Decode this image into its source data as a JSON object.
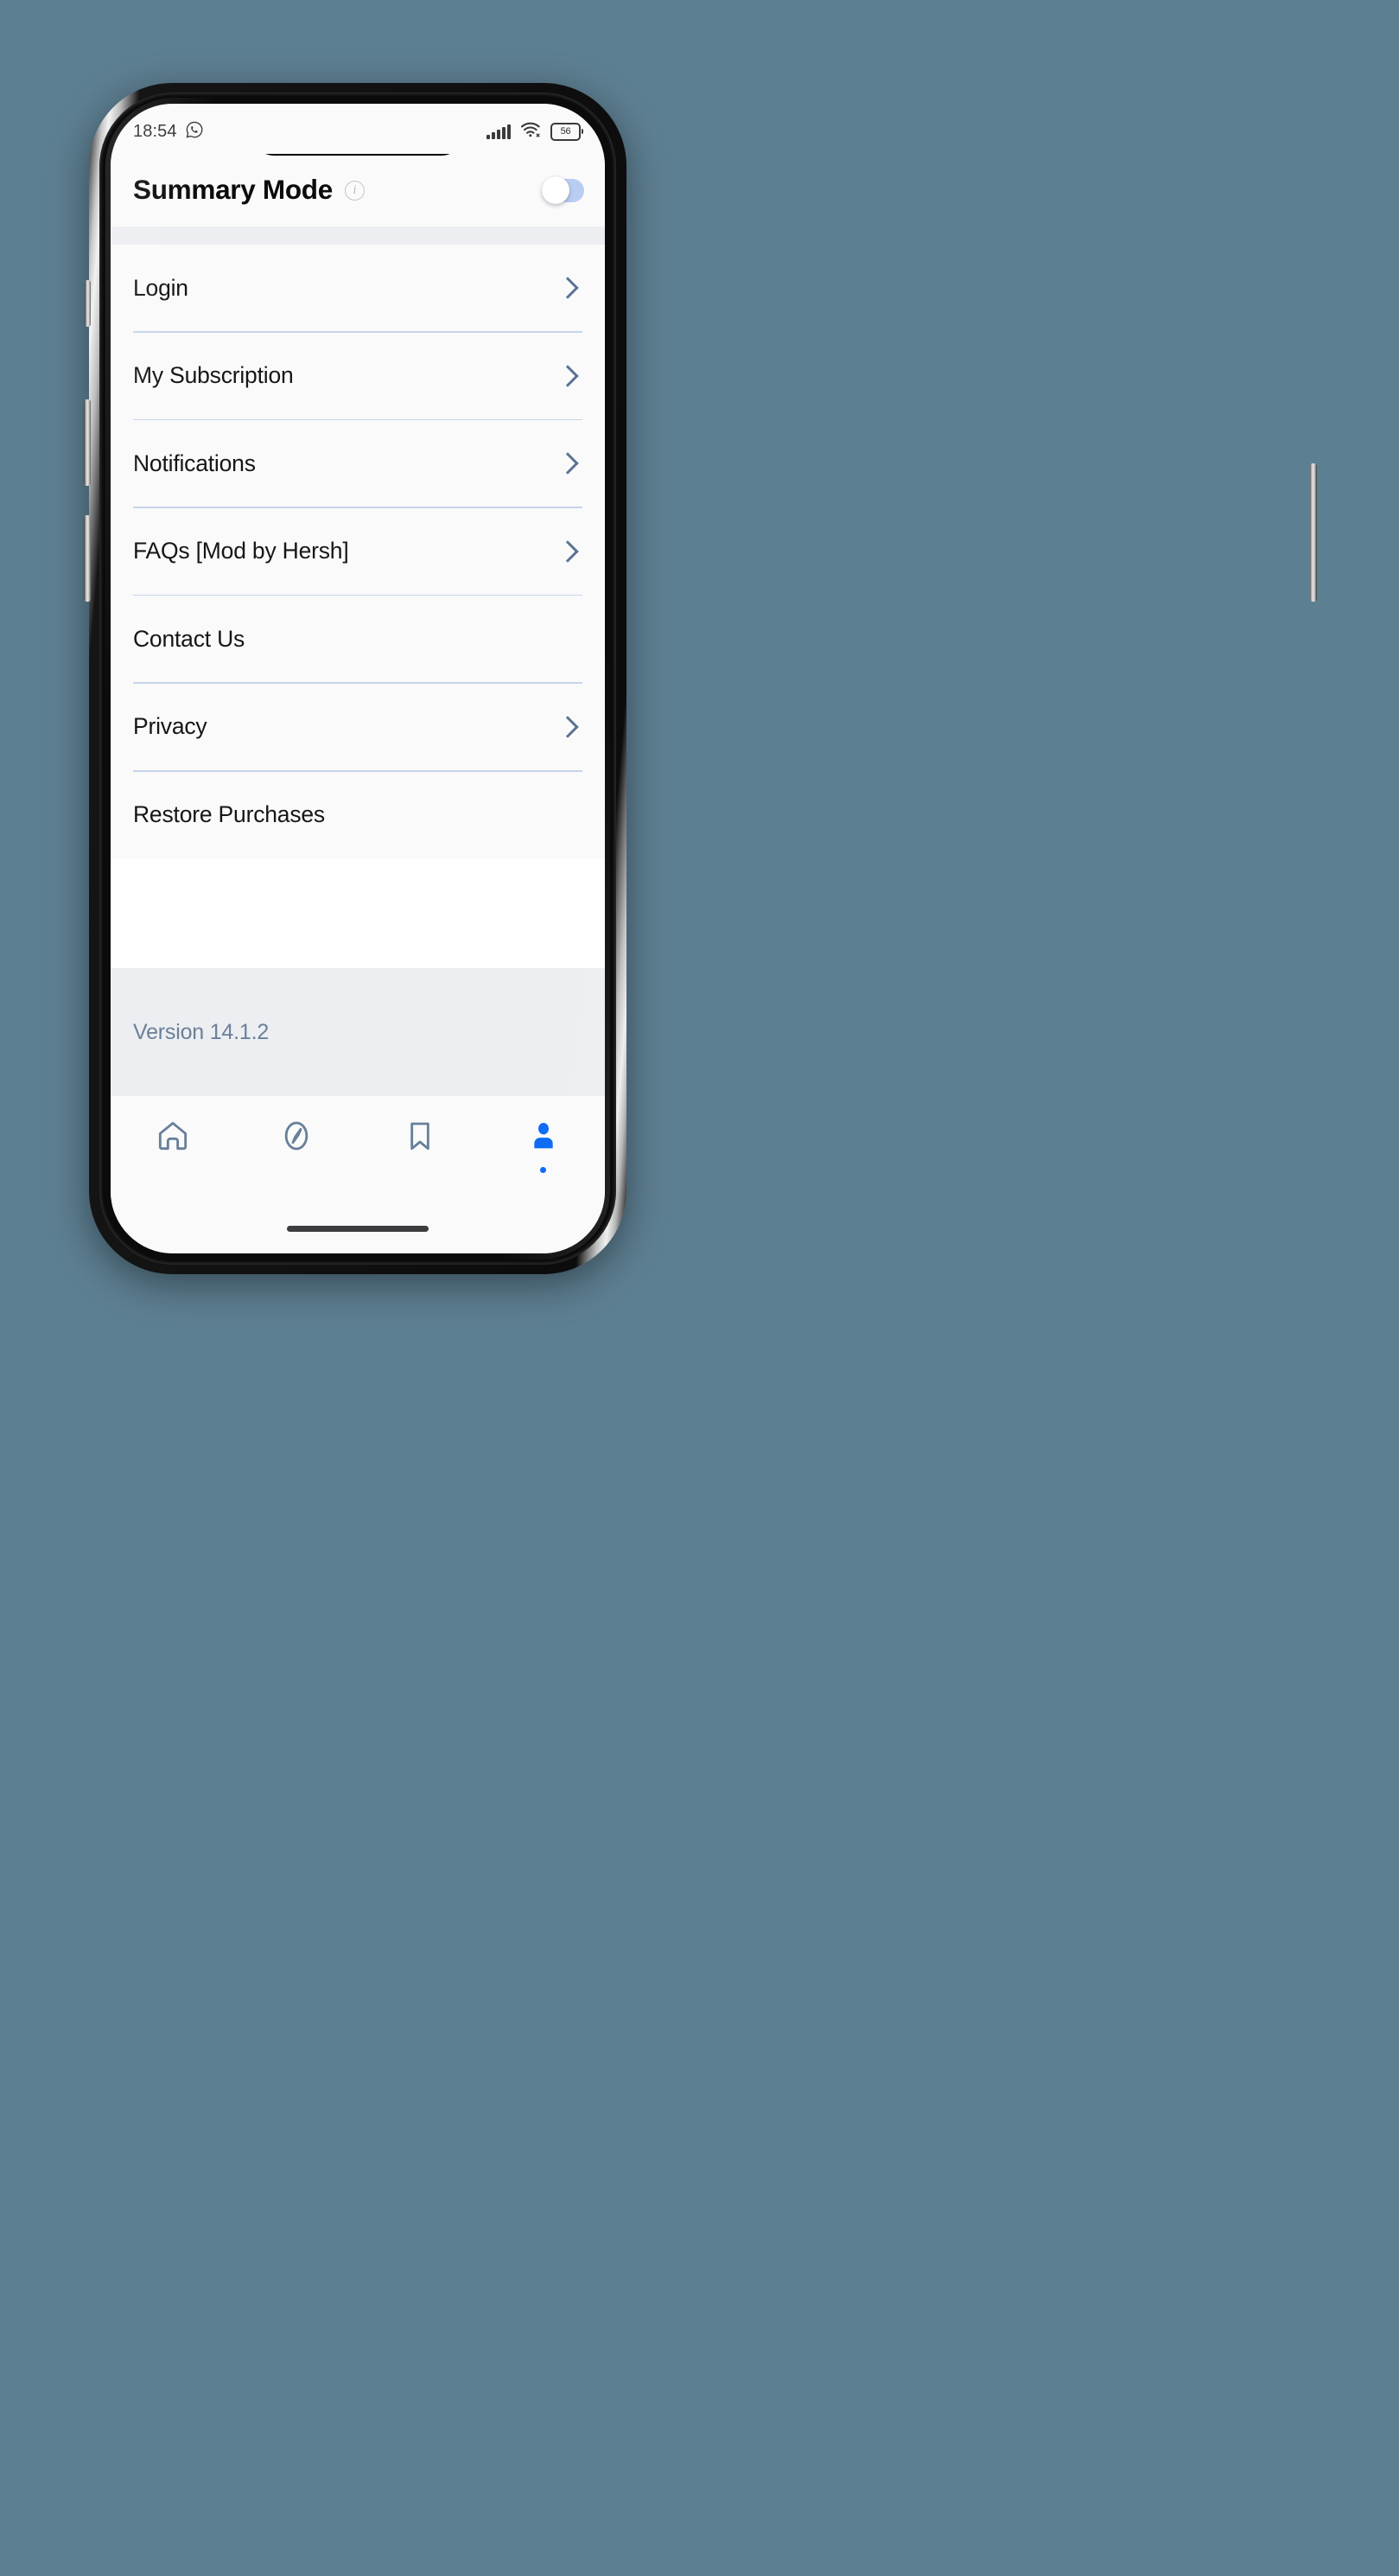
{
  "device": {
    "notch": {
      "speaker": "earpiece-speaker",
      "camera": "front-camera"
    },
    "buttons": [
      "mute-switch",
      "volume-up",
      "volume-down",
      "power"
    ]
  },
  "status_bar": {
    "time": "18:54",
    "left_icon": "whatsapp-icon",
    "signal_icon": "cellular-signal-icon",
    "wifi_icon": "wifi-icon",
    "battery_level": "56",
    "battery_icon": "battery-icon"
  },
  "header": {
    "title": "Summary Mode",
    "info_icon": "info-circle-icon",
    "toggle": {
      "name": "summary-mode-toggle",
      "state": "off",
      "track_color": "#b9cdf2",
      "knob_color": "#ffffff"
    }
  },
  "menu": {
    "items": [
      {
        "label": "Login",
        "chevron": true
      },
      {
        "label": "My Subscription",
        "chevron": true
      },
      {
        "label": "Notifications",
        "chevron": true
      },
      {
        "label": "FAQs [Mod by Hersh]",
        "chevron": true
      },
      {
        "label": "Contact Us",
        "chevron": false
      },
      {
        "label": "Privacy",
        "chevron": true
      },
      {
        "label": "Restore Purchases",
        "chevron": false
      }
    ]
  },
  "footer": {
    "version_text": "Version 14.1.2"
  },
  "bottom_nav": {
    "items": [
      {
        "icon": "home-icon",
        "active": false
      },
      {
        "icon": "compass-icon",
        "active": false
      },
      {
        "icon": "bookmark-icon",
        "active": false
      },
      {
        "icon": "profile-icon",
        "active": true
      }
    ],
    "active_color": "#0a68f5",
    "inactive_color": "#687f99"
  },
  "colors": {
    "page_background": "#5d7f92",
    "screen_background": "#fafafb",
    "band_background": "#eceef2",
    "divider": "#c7d4ea",
    "chevron": "#5b7490",
    "version_text": "#6b8099"
  }
}
